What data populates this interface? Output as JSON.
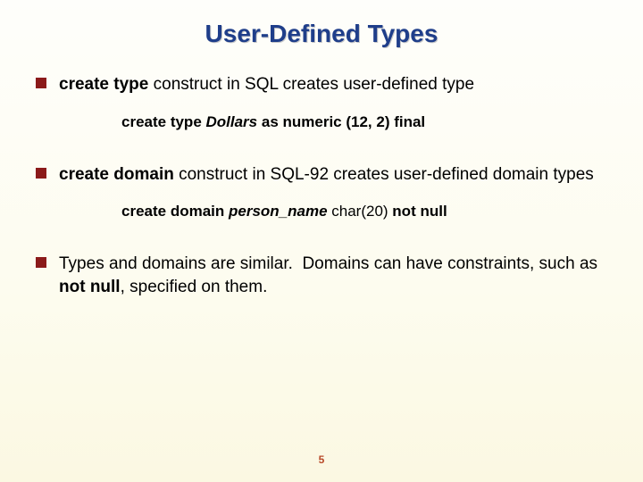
{
  "title": "User-Defined Types",
  "bullets": [
    {
      "text_html": "<b>create type</b> construct in SQL creates user-defined type"
    },
    {
      "text_html": "<b>create domain</b> construct in SQL-92 creates user-defined domain types"
    },
    {
      "text_html": "Types and domains are similar.&nbsp; Domains can have constraints, such as <b>not null</b>, specified on them."
    }
  ],
  "sublines": [
    {
      "html": "create type <span class=\"em\">Dollars</span> as numeric (12, 2) final"
    },
    {
      "html": "create domain <span class=\"em\">person_name&nbsp;</span><span class=\"thin\">char(20)</span> not null"
    }
  ],
  "page_number": "5"
}
